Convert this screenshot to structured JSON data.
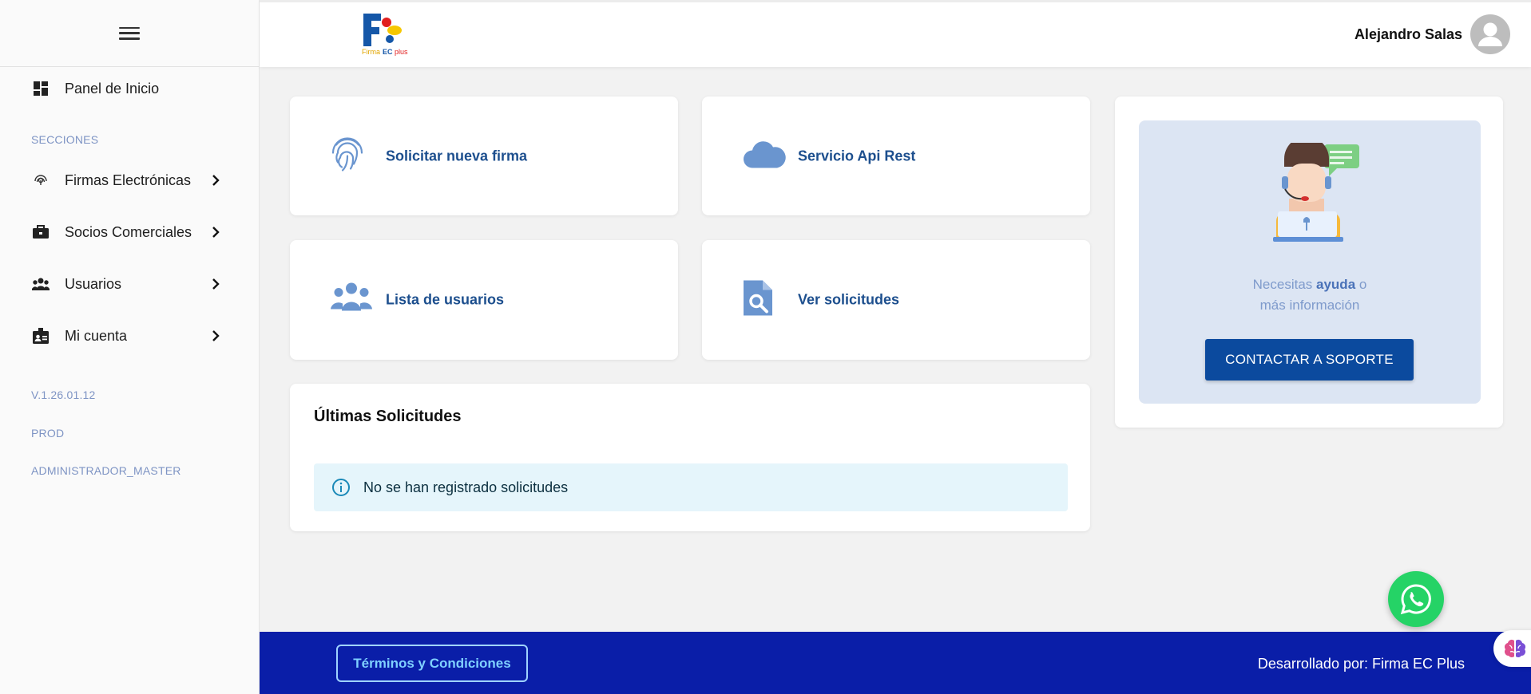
{
  "sidebar": {
    "items": [
      {
        "label": "Panel de Inicio",
        "icon": "dashboard-icon"
      },
      {
        "label": "Firmas Electrónicas",
        "icon": "fingerprint-icon"
      },
      {
        "label": "Socios Comerciales",
        "icon": "briefcase-icon"
      },
      {
        "label": "Usuarios",
        "icon": "group-icon"
      },
      {
        "label": "Mi cuenta",
        "icon": "badge-icon"
      }
    ],
    "section_label": "SECCIONES",
    "version": "V.1.26.01.12",
    "environment": "PROD",
    "role": "ADMINISTRADOR_MASTER"
  },
  "header": {
    "logo_text": "Firma EC plus",
    "user_name": "Alejandro Salas"
  },
  "actions": [
    {
      "label": "Solicitar nueva firma",
      "icon": "fingerprint-icon"
    },
    {
      "label": "Servicio Api Rest",
      "icon": "cloud-icon"
    },
    {
      "label": "Lista de usuarios",
      "icon": "users-icon"
    },
    {
      "label": "Ver solicitudes",
      "icon": "document-search-icon"
    }
  ],
  "recent": {
    "title": "Últimas Solicitudes",
    "empty_message": "No se han registrado solicitudes"
  },
  "support": {
    "text_before": "Necesitas ",
    "text_bold": "ayuda",
    "text_after": " o",
    "text_line2": "más información",
    "button_label": "CONTACTAR A SOPORTE"
  },
  "footer": {
    "terms_label": "Términos y Condiciones",
    "developed_by": "Desarrollado por: Firma EC Plus"
  },
  "colors": {
    "accent": "#0b4a9e",
    "footer": "#0a1ea8",
    "action_text": "#1d4f8e",
    "icon": "#6a95cf",
    "whatsapp": "#25d366"
  }
}
